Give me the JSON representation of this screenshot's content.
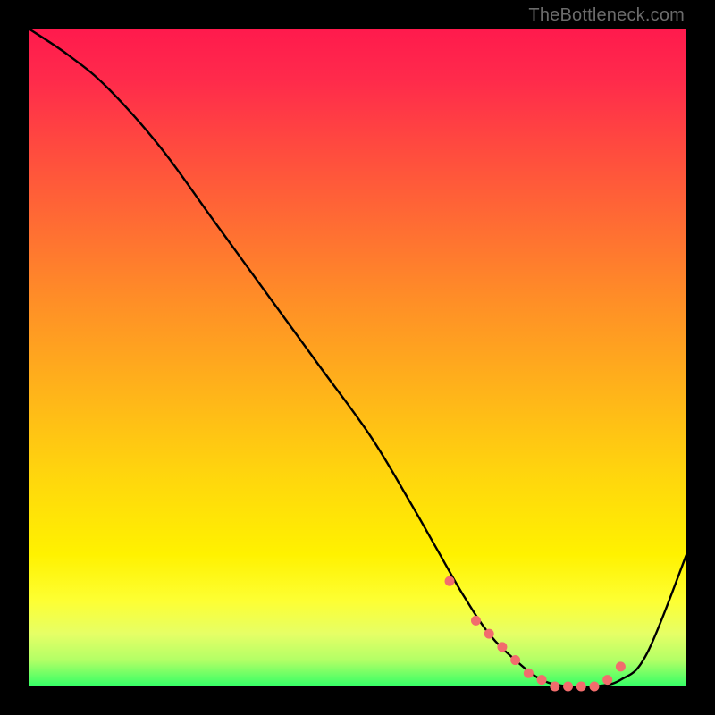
{
  "attribution": "TheBottleneck.com",
  "chart_data": {
    "type": "line",
    "title": "",
    "xlabel": "",
    "ylabel": "",
    "xlim": [
      0,
      100
    ],
    "ylim": [
      0,
      100
    ],
    "series": [
      {
        "name": "bottleneck-curve",
        "x": [
          0,
          6,
          12,
          20,
          28,
          36,
          44,
          52,
          58,
          62,
          66,
          70,
          74,
          78,
          82,
          86,
          90,
          94,
          100
        ],
        "y": [
          100,
          96,
          91,
          82,
          71,
          60,
          49,
          38,
          28,
          21,
          14,
          8,
          4,
          1,
          0,
          0,
          1,
          5,
          20
        ]
      }
    ],
    "markers": {
      "name": "highlight-points",
      "color": "#f26d6d",
      "x": [
        64,
        68,
        70,
        72,
        74,
        76,
        78,
        80,
        82,
        84,
        86,
        88,
        90
      ],
      "y": [
        16,
        10,
        8,
        6,
        4,
        2,
        1,
        0,
        0,
        0,
        0,
        1,
        3
      ]
    }
  }
}
